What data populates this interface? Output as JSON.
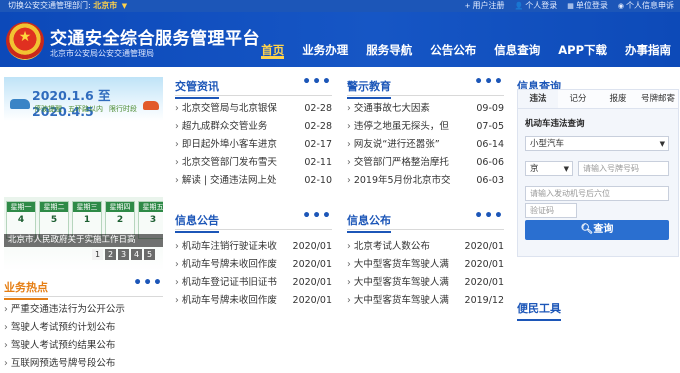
{
  "topbar": {
    "switch_label": "切换公安交通管理部门:",
    "city": "北京市",
    "links": [
      {
        "icon": "user-plus-icon",
        "label": "用户注册"
      },
      {
        "icon": "person-icon",
        "label": "个人登录"
      },
      {
        "icon": "building-icon",
        "label": "单位登录"
      },
      {
        "icon": "person-circle-icon",
        "label": "个人信息申诉"
      }
    ]
  },
  "header": {
    "title": "交通安全综合服务管理平台",
    "subtitle": "北京市公安局公安交通管理局",
    "nav": [
      "首页",
      "业务办理",
      "服务导航",
      "公告公布",
      "信息查询",
      "APP下载",
      "办事指南"
    ],
    "active_nav": "首页"
  },
  "left": {
    "banner1": {
      "dates": "2020.1.6 至 2020.4.5",
      "hints": [
        "停驶提醒",
        "五环路以内",
        "限行时段"
      ]
    },
    "banner2": {
      "calendar": [
        {
          "hd": "星期一",
          "num": "4"
        },
        {
          "hd": "星期二",
          "num": "5"
        },
        {
          "hd": "星期三",
          "num": "1"
        },
        {
          "hd": "星期四",
          "num": "2"
        },
        {
          "hd": "星期五",
          "num": "3"
        }
      ],
      "caption": "北京市人民政府关于实施工作日高",
      "pages": [
        "1",
        "2",
        "3",
        "4",
        "5"
      ],
      "active_page": "1"
    },
    "hot": {
      "title": "业务热点",
      "more": "•••",
      "items": [
        "严重交通违法行为公开公示",
        "驾驶人考试预约计划公布",
        "驾驶人考试预约结果公布",
        "互联网预选号牌号段公布"
      ]
    }
  },
  "news": {
    "title": "交管资讯",
    "more": "•••",
    "items": [
      {
        "text": "北京交管局与北京银保",
        "date": "02-28"
      },
      {
        "text": "超九成群众交管业务",
        "date": "02-28"
      },
      {
        "text": "即日起外埠小客车进京",
        "date": "02-17"
      },
      {
        "text": "北京交管部门发布雪天",
        "date": "02-11"
      },
      {
        "text": "解读 | 交通违法网上处",
        "date": "02-10"
      }
    ]
  },
  "warning": {
    "title": "警示教育",
    "more": "•••",
    "items": [
      {
        "text": "交通事故七大因素",
        "date": "09-09"
      },
      {
        "text": "违停之地虽无探头，但",
        "date": "07-05"
      },
      {
        "text": "网友说“进行还嚣张”",
        "date": "06-14"
      },
      {
        "text": "交管部门严格整治摩托",
        "date": "06-06"
      },
      {
        "text": "2019年5月份北京市交",
        "date": "06-03"
      }
    ]
  },
  "info_notice": {
    "title": "信息公告",
    "more": "•••",
    "items": [
      {
        "text": "机动车注销行驶证未收",
        "date": "2020/01"
      },
      {
        "text": "机动车号牌未收回作废",
        "date": "2020/01"
      },
      {
        "text": "机动车登记证书旧证书",
        "date": "2020/01"
      },
      {
        "text": "机动车号牌未收回作废",
        "date": "2020/01"
      }
    ]
  },
  "info_publish": {
    "title": "信息公布",
    "more": "•••",
    "items": [
      {
        "text": "北京考试人数公布",
        "date": "2020/01"
      },
      {
        "text": "大中型客货车驾驶人满",
        "date": "2020/01"
      },
      {
        "text": "大中型客货车驾驶人满",
        "date": "2020/01"
      },
      {
        "text": "大中型客货车驾驶人满",
        "date": "2019/12"
      }
    ]
  },
  "query": {
    "title": "信息查询",
    "tabs": [
      "违法",
      "记分",
      "报废",
      "号牌邮寄"
    ],
    "active_tab": "违法",
    "label": "机动车违法查询",
    "vehicle_type": "小型汽车",
    "province": "京",
    "plate_placeholder": "请输入号牌号码",
    "engine_placeholder": "请输入发动机号后六位",
    "captcha_placeholder": "验证码",
    "submit": "查询"
  },
  "tools": {
    "title": "便民工具"
  },
  "colors": {
    "brand": "#1c56b8",
    "nav_active": "#ffd34d",
    "hot": "#e57e14",
    "button": "#2a6fd0"
  }
}
